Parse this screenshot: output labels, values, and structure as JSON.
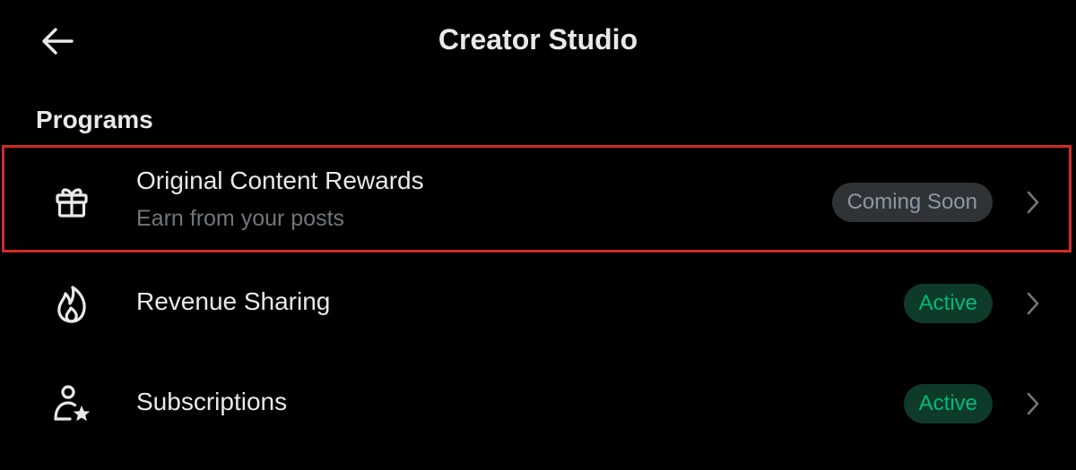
{
  "header": {
    "back_icon": "arrow-left-icon",
    "title": "Creator Studio"
  },
  "section": {
    "title": "Programs"
  },
  "programs": [
    {
      "icon": "gift-icon",
      "label": "Original Content Rewards",
      "subtitle": "Earn from your posts",
      "badge": "Coming Soon",
      "badge_status": "coming-soon",
      "highlighted": true,
      "chevron_icon": "chevron-right-icon"
    },
    {
      "icon": "flame-icon",
      "label": "Revenue Sharing",
      "badge": "Active",
      "badge_status": "active",
      "chevron_icon": "chevron-right-icon"
    },
    {
      "icon": "person-star-icon",
      "label": "Subscriptions",
      "badge": "Active",
      "badge_status": "active",
      "chevron_icon": "chevron-right-icon"
    }
  ],
  "colors": {
    "background": "#000000",
    "text_primary": "#e7e9ea",
    "text_secondary": "#71767b",
    "badge_soon_bg": "#2f3336",
    "badge_soon_text": "#8b98a5",
    "badge_active_bg": "#0e3a2a",
    "badge_active_text": "#00ba7c",
    "highlight_border": "#d12a2a"
  }
}
